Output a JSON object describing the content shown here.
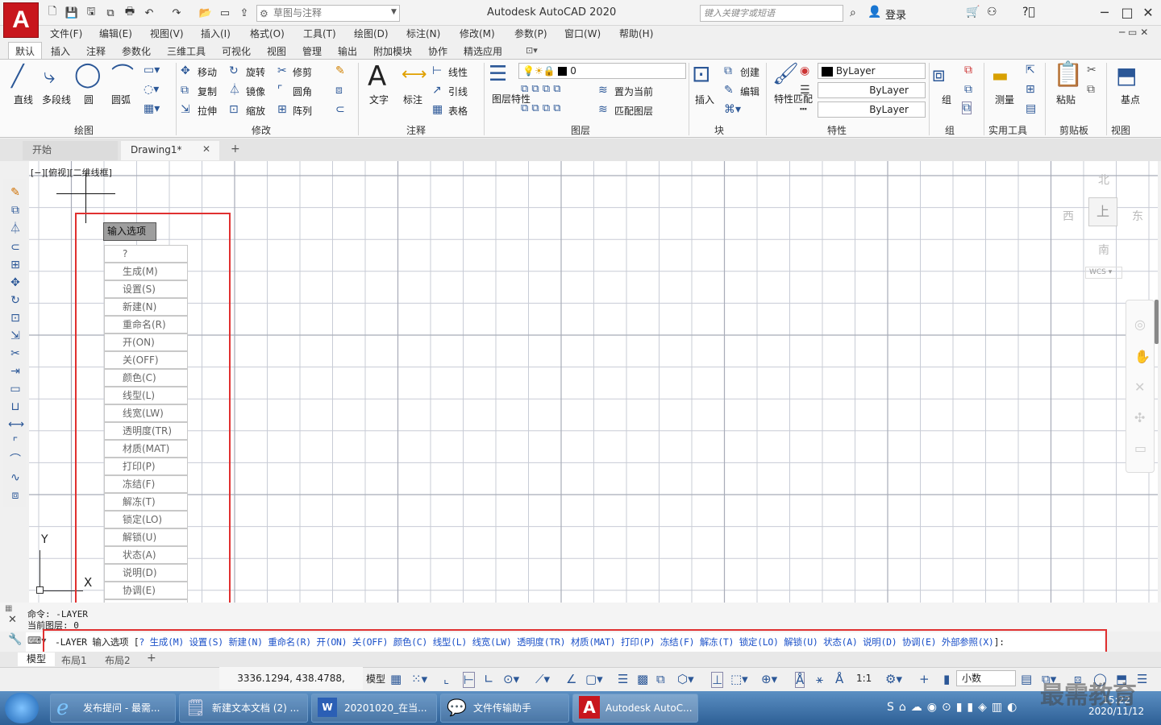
{
  "titlebar": {
    "app_icon": "A",
    "workspace": "草图与注释",
    "window_title": "Autodesk AutoCAD 2020",
    "search_placeholder": "键入关键字或短语",
    "login": "登录",
    "minimize": "─",
    "maximize": "□",
    "close": "✕"
  },
  "menubar": [
    "文件(F)",
    "编辑(E)",
    "视图(V)",
    "插入(I)",
    "格式(O)",
    "工具(T)",
    "绘图(D)",
    "标注(N)",
    "修改(M)",
    "参数(P)",
    "窗口(W)",
    "帮助(H)"
  ],
  "ribbon_tabs": [
    "默认",
    "插入",
    "注释",
    "参数化",
    "三维工具",
    "可视化",
    "视图",
    "管理",
    "输出",
    "附加模块",
    "协作",
    "精选应用"
  ],
  "ribbon": {
    "draw": {
      "line": "直线",
      "polyline": "多段线",
      "circle": "圆",
      "arc": "圆弧",
      "title": "绘图"
    },
    "modify": {
      "move": "移动",
      "rotate": "旋转",
      "trim": "修剪",
      "copy": "复制",
      "mirror": "镜像",
      "fillet": "圆角",
      "stretch": "拉伸",
      "scale": "缩放",
      "array": "阵列",
      "title": "修改"
    },
    "annotation": {
      "text": "文字",
      "dimension": "标注",
      "leader": "线性",
      "mleader": "引线",
      "table": "表格",
      "title": "注释"
    },
    "layers": {
      "props": "图层特性",
      "current_layer": "0",
      "set_current": "置为当前",
      "match_layer": "匹配图层",
      "title": "图层"
    },
    "block": {
      "insert": "插入",
      "create": "创建",
      "edit": "编辑",
      "title": "块"
    },
    "properties": {
      "match": "特性匹配",
      "color": "ByLayer",
      "linetype": "ByLayer",
      "lineweight": "ByLayer",
      "title": "特性"
    },
    "groups": {
      "group": "组",
      "title": "组"
    },
    "utilities": {
      "measure": "测量",
      "title": "实用工具"
    },
    "clipboard": {
      "paste": "粘贴",
      "title": "剪贴板"
    },
    "view": {
      "base": "基点",
      "title": "视图"
    }
  },
  "doc_tabs": {
    "start": "开始",
    "drawing": "Drawing1*",
    "close": "✕",
    "add": "+"
  },
  "viewport": {
    "label": "[−][俯视][二维线框]",
    "viewcube": {
      "north": "北",
      "south": "南",
      "east": "东",
      "west": "西",
      "top": "上",
      "wcs": "WCS"
    },
    "ucs_x": "X",
    "ucs_y": "Y"
  },
  "input_options": {
    "title": "输入选项",
    "items": [
      "?",
      "生成(M)",
      "设置(S)",
      "新建(N)",
      "重命名(R)",
      "开(ON)",
      "关(OFF)",
      "颜色(C)",
      "线型(L)",
      "线宽(LW)",
      "透明度(TR)",
      "材质(MAT)",
      "打印(P)",
      "冻结(F)",
      "解冻(T)",
      "锁定(LO)",
      "解锁(U)",
      "状态(A)",
      "说明(D)",
      "协调(E)",
      "外部参照(X)"
    ]
  },
  "command": {
    "history1": "命令:  -LAYER",
    "history2": "当前图层:  0",
    "prompt": "-LAYER 输入选项",
    "options": [
      "?",
      "生成(M)",
      "设置(S)",
      "新建(N)",
      "重命名(R)",
      "开(ON)",
      "关(OFF)",
      "颜色(C)",
      "线型(L)",
      "线宽(LW)",
      "透明度(TR)",
      "材质(MAT)",
      "打印(P)",
      "冻结(F)",
      "解冻(T)",
      "锁定(LO)",
      "解锁(U)",
      "状态(A)",
      "说明(D)",
      "协调(E)",
      "外部参照(X)"
    ],
    "suffix": "]:"
  },
  "layout_tabs": [
    "模型",
    "布局1",
    "布局2"
  ],
  "statusbar": {
    "coords": "3336.1294, 438.4788, 0.0000",
    "model": "模型",
    "scale": "1:1",
    "units": "小数"
  },
  "taskbar": {
    "tasks": [
      "发布提问 - 最需...",
      "新建文本文档 (2) ...",
      "20201020_在当...",
      "文件传输助手",
      "Autodesk AutoC..."
    ],
    "time": "15:22",
    "date": "2020/11/12"
  },
  "watermark": "最需教育"
}
